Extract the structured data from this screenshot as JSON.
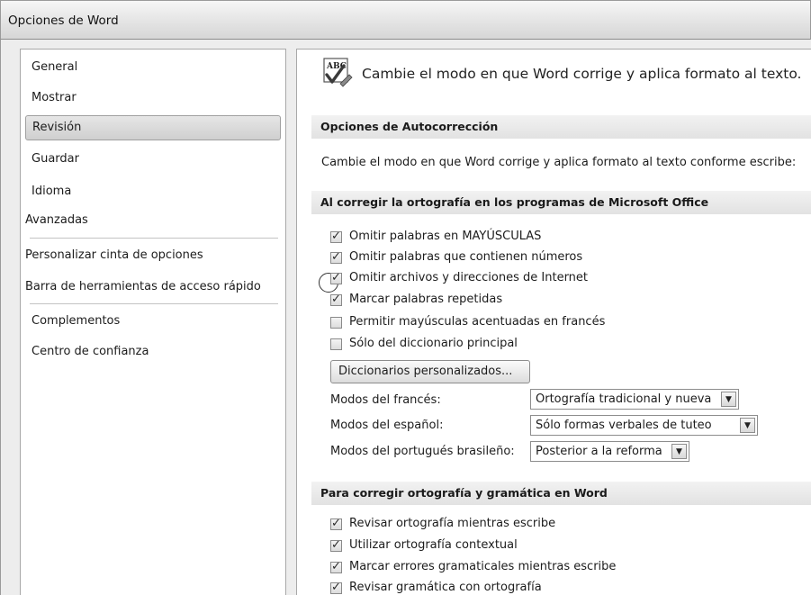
{
  "window": {
    "title": "Opciones de Word"
  },
  "sidebar": {
    "items": [
      {
        "label": "General"
      },
      {
        "label": "Mostrar"
      },
      {
        "label": "Revisión"
      },
      {
        "label": "Guardar"
      },
      {
        "label": "Idioma"
      },
      {
        "label": "Avanzadas"
      },
      {
        "label": "Personalizar cinta de opciones"
      },
      {
        "label": "Barra de herramientas de acceso rápido"
      },
      {
        "label": "Complementos"
      },
      {
        "label": "Centro de confianza"
      }
    ],
    "selected": "Revisión"
  },
  "main": {
    "header_text": "Cambie el modo en que Word corrige y aplica formato al texto.",
    "icon": "abc-spellcheck-icon",
    "autocorrect": {
      "title": "Opciones de Autocorrección",
      "description": "Cambie el modo en que Word corrige y aplica formato al texto conforme escribe:"
    },
    "office_spelling": {
      "title": "Al corregir la ortografía en los programas de Microsoft Office",
      "options": [
        {
          "label": "Omitir palabras en MAYÚSCULAS",
          "checked": true
        },
        {
          "label": "Omitir palabras que contienen números",
          "checked": true
        },
        {
          "label": "Omitir archivos y direcciones de Internet",
          "checked": true
        },
        {
          "label": "Marcar palabras repetidas",
          "checked": true
        },
        {
          "label": "Permitir mayúsculas acentuadas en francés",
          "checked": false
        },
        {
          "label": "Sólo del diccionario principal",
          "checked": false
        }
      ],
      "custom_dictionaries_button": "Diccionarios personalizados...",
      "modes": [
        {
          "label": "Modos del francés:",
          "value": "Ortografía tradicional y nueva"
        },
        {
          "label": "Modos del español:",
          "value": "Sólo formas verbales de tuteo"
        },
        {
          "label": "Modos del portugués brasileño:",
          "value": "Posterior a la reforma"
        }
      ]
    },
    "word_grammar": {
      "title": "Para corregir ortografía y gramática en Word",
      "options": [
        {
          "label": "Revisar ortografía mientras escribe",
          "checked": true
        },
        {
          "label": "Utilizar ortografía contextual",
          "checked": true
        },
        {
          "label": "Marcar errores gramaticales mientras escribe",
          "checked": true
        },
        {
          "label": "Revisar gramática con ortografía",
          "checked": true
        }
      ]
    }
  },
  "colors": {
    "selected_bg": "#d8d8d8",
    "frame_bg": "#ededed",
    "section_header_bg": "#e6e6e6"
  }
}
